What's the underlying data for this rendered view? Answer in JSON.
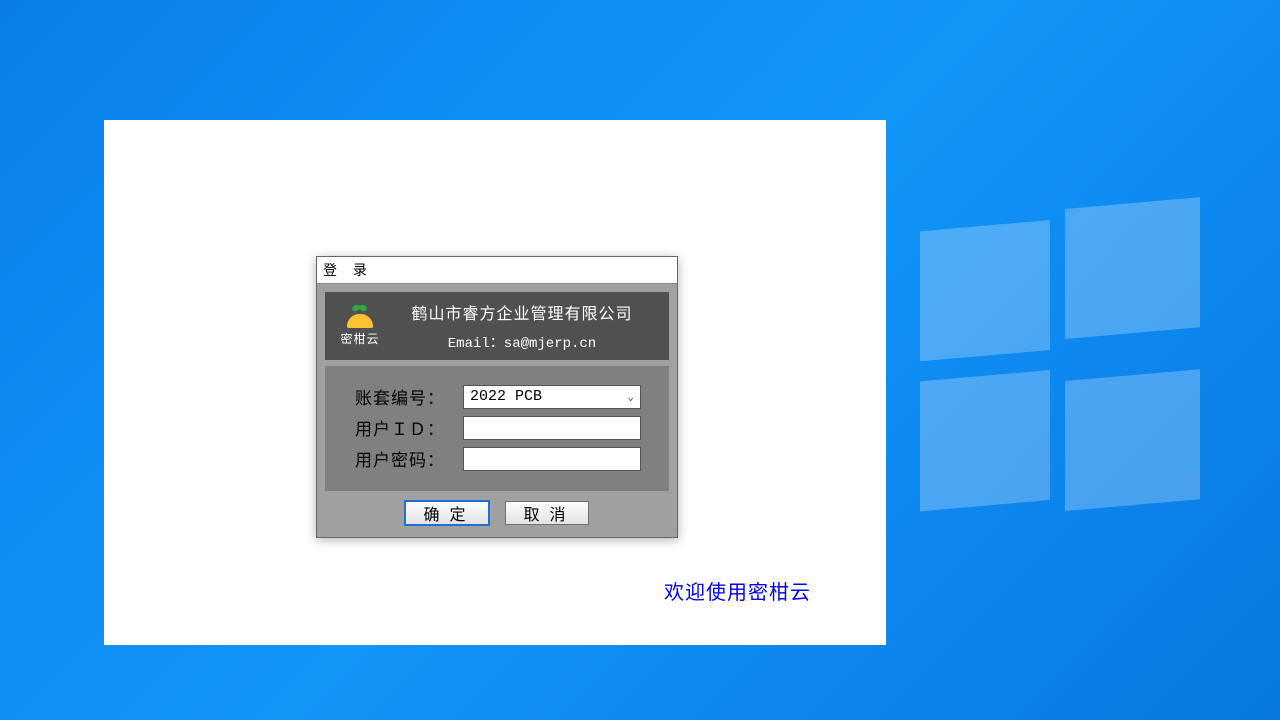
{
  "desktop": {
    "welcome_text": "欢迎使用密柑云"
  },
  "dialog": {
    "title": "登 录",
    "header": {
      "logo_label": "密柑云",
      "company_name": "鹤山市睿方企业管理有限公司",
      "email_line": "Email：sa@mjerp.cn"
    },
    "form": {
      "account_label": "账套编号：",
      "account_value": "2022 PCB",
      "user_id_label": "用户ＩＤ：",
      "user_id_value": "",
      "password_label": "用户密码：",
      "password_value": ""
    },
    "buttons": {
      "ok": "确定",
      "cancel": "取消"
    }
  }
}
